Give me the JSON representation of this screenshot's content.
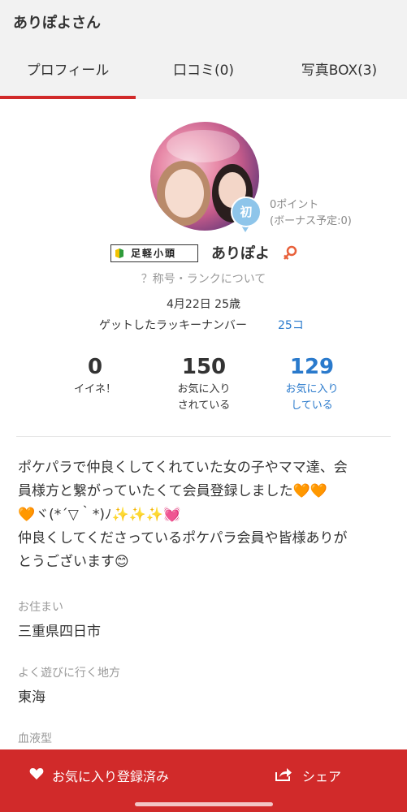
{
  "header": {
    "title": "ありぽよさん"
  },
  "tabs": [
    {
      "label": "プロフィール",
      "active": true
    },
    {
      "label": "口コミ(0)"
    },
    {
      "label": "写真BOX(3)"
    }
  ],
  "profile": {
    "rank_badge": "初",
    "points": "0ポイント",
    "bonus": "(ボーナス予定:0)",
    "title_badge": "足軽小頭",
    "username": "ありぽよ",
    "rank_link": "？称号・ランクについて",
    "birthday": "4月22日 25歳",
    "lucky_label": "ゲットしたラッキーナンバー",
    "lucky_value": "25コ"
  },
  "stats": [
    {
      "value": "0",
      "label1": "イイネ！",
      "label2": ""
    },
    {
      "value": "150",
      "label1": "お気に入り",
      "label2": "されている"
    },
    {
      "value": "129",
      "label1": "お気に入り",
      "label2": "している"
    }
  ],
  "bio": {
    "line1": "ポケパラで仲良くしてくれていた女の子やママ達、会",
    "line2": "員様方と繋がっていたくて会員登録しました🧡🧡",
    "line3": "🧡ヾ(*´▽｀*)ﾉ✨✨✨💓",
    "line4": "仲良くしてくださっているポケパラ会員や皆様ありが",
    "line5": "とうございます😊"
  },
  "fields": {
    "residence_label": "お住まい",
    "residence_value": "三重県四日市",
    "area_label": "よく遊びに行く地方",
    "area_value": "東海",
    "blood_label": "血液型"
  },
  "bottom": {
    "favorite_label": "お気に入り登録済み",
    "share_label": "シェア"
  },
  "colors": {
    "accent": "#d12a2a",
    "link": "#2a7acc",
    "rank_badge": "#8ec5ea"
  }
}
